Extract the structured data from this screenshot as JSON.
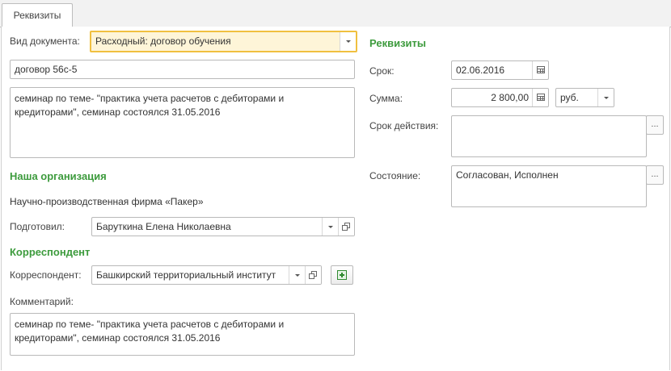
{
  "tabs": [
    {
      "label": "Реквизиты"
    }
  ],
  "left": {
    "doc_type_label": "Вид документа:",
    "doc_type_value": "Расходный: договор обучения",
    "doc_name_value": "договор 56с-5",
    "description_value": "семинар по теме- \"практика учета расчетов с дебиторами и кредиторами\", семинар состоялся 31.05.2016",
    "our_org_heading": "Наша организация",
    "org_name": "Научно-производственная фирма «Пакер»",
    "prepared_label": "Подготовил:",
    "prepared_value": "Баруткина Елена Николаевна",
    "correspondent_heading": "Корреспондент",
    "correspondent_label": "Корреспондент:",
    "correspondent_value": "Башкирский территориальный институт",
    "comment_label": "Комментарий:",
    "comment_value": "семинар по теме- \"практика учета расчетов с дебиторами и кредиторами\", семинар состоялся 31.05.2016"
  },
  "right": {
    "heading": "Реквизиты",
    "term_label": "Срок:",
    "term_value": "02.06.2016",
    "amount_label": "Сумма:",
    "amount_value": "2 800,00",
    "currency_value": "руб.",
    "validity_label": "Срок действия:",
    "validity_value": "",
    "state_label": "Состояние:",
    "state_value": "Согласован, Исполнен",
    "more_button": "..."
  },
  "colors": {
    "section_heading": "#3d9b3d",
    "focus_border": "#f0c040",
    "focus_bg": "#fef5d8"
  },
  "icons": [
    "dropdown-arrow-icon",
    "open-form-icon",
    "calendar-icon",
    "calculator-icon",
    "add-icon"
  ]
}
